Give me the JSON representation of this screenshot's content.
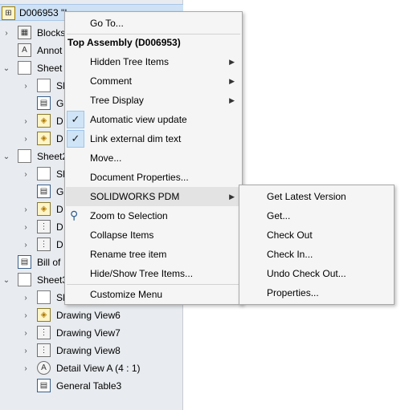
{
  "tree": {
    "root_label": "D006953 \"I",
    "rows": [
      {
        "label": "Blocks",
        "icon": "block-icon"
      },
      {
        "label": "Annot",
        "icon": "annotation-icon"
      },
      {
        "label": "Sheet",
        "icon": "sheet-icon"
      },
      {
        "label": "Sl",
        "icon": "sheet-format-icon"
      },
      {
        "label": "G",
        "icon": "table-icon"
      },
      {
        "label": "D",
        "icon": "drawing-view-icon"
      },
      {
        "label": "D",
        "icon": "drawing-view-icon"
      },
      {
        "label": "Sheet2",
        "icon": "sheet-icon"
      },
      {
        "label": "Sl",
        "icon": "sheet-format-icon"
      },
      {
        "label": "G",
        "icon": "table-icon"
      },
      {
        "label": "D",
        "icon": "drawing-view-icon"
      },
      {
        "label": "D",
        "icon": "drawing-view-icon"
      },
      {
        "label": "D",
        "icon": "drawing-view-icon"
      },
      {
        "label": "Bill of",
        "icon": "bom-icon"
      },
      {
        "label": "Sheet3",
        "icon": "sheet-icon"
      },
      {
        "label": "Sl",
        "icon": "sheet-format-icon"
      },
      {
        "label": "Drawing View6",
        "icon": "drawing-view-icon"
      },
      {
        "label": "Drawing View7",
        "icon": "drawing-view-icon"
      },
      {
        "label": "Drawing View8",
        "icon": "drawing-view-icon"
      },
      {
        "label": "Detail View A (4 : 1)",
        "icon": "detail-view-icon"
      },
      {
        "label": "General Table3",
        "icon": "table-icon"
      }
    ]
  },
  "context_menu": {
    "goto": "Go To...",
    "header": "Top Assembly (D006953)",
    "items": [
      {
        "label": "Hidden Tree Items",
        "submenu": true
      },
      {
        "label": "Comment",
        "submenu": true
      },
      {
        "label": "Tree Display",
        "submenu": true
      },
      {
        "label": "Automatic view update",
        "checked": true
      },
      {
        "label": "Link external dim text",
        "checked": true
      },
      {
        "label": "Move..."
      },
      {
        "label": "Document Properties..."
      },
      {
        "label": "SOLIDWORKS PDM",
        "submenu": true,
        "highlighted": true
      },
      {
        "label": "Zoom to Selection",
        "icon": "zoom-icon"
      },
      {
        "label": "Collapse Items"
      },
      {
        "label": "Rename tree item"
      },
      {
        "label": "Hide/Show Tree Items..."
      },
      {
        "label": "Customize Menu"
      }
    ]
  },
  "pdm_submenu": {
    "items": [
      "Get Latest Version",
      "Get...",
      "Check Out",
      "Check In...",
      "Undo Check Out...",
      "Properties..."
    ]
  },
  "colors": {
    "highlight": "#e3e3e3",
    "check_bg": "#cfe4f7",
    "tree_bg": "#e8ebef",
    "selected_row": "#cfe2f5"
  }
}
